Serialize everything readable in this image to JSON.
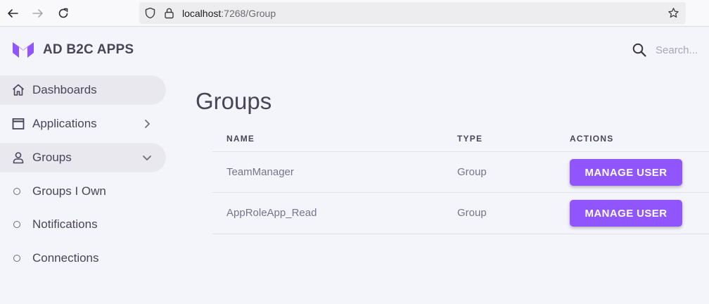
{
  "browser": {
    "url_host": "localhost",
    "url_path": ":7268/Group"
  },
  "app": {
    "brand": "AD B2C APPS",
    "accent_color": "#9155fd",
    "logo_icon": "m-logo-icon"
  },
  "search": {
    "placeholder": "Search..."
  },
  "sidebar": {
    "items": [
      {
        "label": "Dashboards",
        "icon": "home-icon",
        "active": true
      },
      {
        "label": "Applications",
        "icon": "window-icon",
        "chevron": "right"
      },
      {
        "label": "Groups",
        "icon": "user-icon",
        "active": true,
        "chevron": "down"
      },
      {
        "label": "Groups I Own",
        "icon": "circle-icon"
      },
      {
        "label": "Notifications",
        "icon": "circle-icon"
      },
      {
        "label": "Connections",
        "icon": "circle-icon"
      }
    ]
  },
  "main": {
    "title": "Groups",
    "table": {
      "headers": [
        "NAME",
        "TYPE",
        "ACTIONS"
      ],
      "rows": [
        {
          "name": "TeamManager",
          "type": "Group",
          "action": "MANAGE USER"
        },
        {
          "name": "AppRoleApp_Read",
          "type": "Group",
          "action": "MANAGE USER"
        }
      ]
    }
  }
}
